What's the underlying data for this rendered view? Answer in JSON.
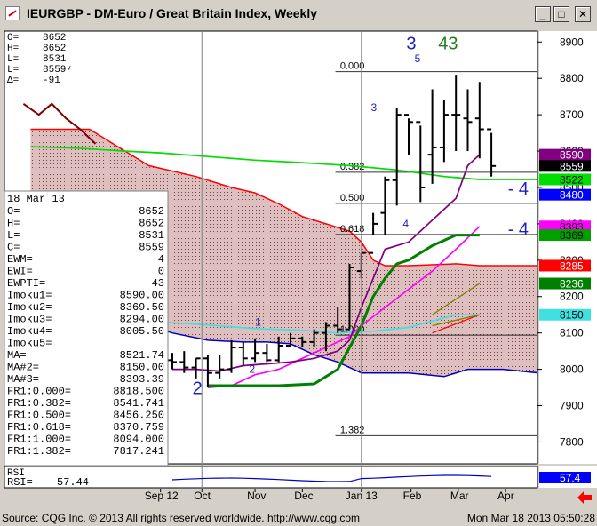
{
  "window": {
    "title": "IEURGBP - DM-Euro / Great Britain Index, Weekly",
    "buttons": [
      "_",
      "□",
      "✕"
    ]
  },
  "top_readout": [
    {
      "k": "O=",
      "v": "8652"
    },
    {
      "k": "H=",
      "v": "8652"
    },
    {
      "k": "L=",
      "v": "8531"
    },
    {
      "k": "L=",
      "v": "8559ᵛ"
    },
    {
      "k": "Δ=",
      "v": "-91"
    }
  ],
  "info_panel": {
    "date": "18 Mar 13",
    "rows": [
      {
        "k": "O=",
        "v": "8652"
      },
      {
        "k": "H=",
        "v": "8652"
      },
      {
        "k": "L=",
        "v": "8531"
      },
      {
        "k": "C=",
        "v": "8559"
      },
      {
        "k": "EWM=",
        "v": "4"
      },
      {
        "k": "EWI=",
        "v": "0"
      },
      {
        "k": "EWPTI=",
        "v": "43"
      },
      {
        "k": "Imoku1=",
        "v": "8590.00"
      },
      {
        "k": "Imoku2=",
        "v": "8369.50"
      },
      {
        "k": "Imoku3=",
        "v": "8294.00"
      },
      {
        "k": "Imoku4=",
        "v": "8005.50"
      },
      {
        "k": "Imoku5=",
        "v": ""
      },
      {
        "k": "MA=",
        "v": "8521.74"
      },
      {
        "k": "MA#2=",
        "v": "8150.00"
      },
      {
        "k": "MA#3=",
        "v": "8393.39"
      },
      {
        "k": "FR1:0.000=",
        "v": "8818.500"
      },
      {
        "k": "FR1:0.382=",
        "v": "8541.741"
      },
      {
        "k": "FR1:0.500=",
        "v": "8456.250"
      },
      {
        "k": "FR1:0.618=",
        "v": "8370.759"
      },
      {
        "k": "FR1:1.000=",
        "v": "8094.000"
      },
      {
        "k": "FR1:1.382=",
        "v": "7817.241"
      }
    ]
  },
  "rsi": {
    "label": "RSI",
    "readout_key": "RSI=",
    "readout_val": "57.44",
    "axis_value": "57.4"
  },
  "footer": {
    "left": "Source: CQG Inc. © 2013 All rights reserved worldwide. http://www.cqg.com",
    "right": "Mon Mar 18 2013 05:50:28"
  },
  "chart_data": {
    "type": "ohlc",
    "yticks": [
      7800,
      7900,
      8000,
      8100,
      8200,
      8300,
      8400,
      8500,
      8600,
      8700,
      8800,
      8900
    ],
    "ylim": [
      7740,
      8930
    ],
    "xlabels": [
      {
        "w": -1,
        "t": "Sep 12"
      },
      {
        "w": 2.5,
        "t": "Oct"
      },
      {
        "w": 7,
        "t": "Nov"
      },
      {
        "w": 11,
        "t": "Dec"
      },
      {
        "w": 16,
        "t": "Jan 13"
      },
      {
        "w": 20.2,
        "t": "Feb"
      },
      {
        "w": 24.2,
        "t": "Mar"
      },
      {
        "w": 28.2,
        "t": "Apr"
      }
    ],
    "bars": [
      {
        "o": 8025,
        "h": 8045,
        "l": 8000,
        "c": 8020
      },
      {
        "o": 8020,
        "h": 8050,
        "l": 7990,
        "c": 8005
      },
      {
        "o": 8005,
        "h": 8030,
        "l": 7975,
        "c": 8030
      },
      {
        "o": 8030,
        "h": 8040,
        "l": 7950,
        "c": 7990
      },
      {
        "o": 7990,
        "h": 8040,
        "l": 7975,
        "c": 8000
      },
      {
        "o": 8000,
        "h": 8080,
        "l": 7990,
        "c": 8060
      },
      {
        "o": 8060,
        "h": 8075,
        "l": 8010,
        "c": 8030
      },
      {
        "o": 8030,
        "h": 8085,
        "l": 8020,
        "c": 8045
      },
      {
        "o": 8045,
        "h": 8070,
        "l": 8020,
        "c": 8025
      },
      {
        "o": 8025,
        "h": 8090,
        "l": 8020,
        "c": 8065
      },
      {
        "o": 8065,
        "h": 8100,
        "l": 8060,
        "c": 8085
      },
      {
        "o": 8085,
        "h": 8090,
        "l": 8060,
        "c": 8075
      },
      {
        "o": 8075,
        "h": 8110,
        "l": 8060,
        "c": 8100
      },
      {
        "o": 8100,
        "h": 8130,
        "l": 8050,
        "c": 8120
      },
      {
        "o": 8120,
        "h": 8170,
        "l": 8100,
        "c": 8110
      },
      {
        "o": 8110,
        "h": 8290,
        "l": 8110,
        "c": 8280
      },
      {
        "o": 8270,
        "h": 8320,
        "l": 8250,
        "c": 8320
      },
      {
        "o": 8320,
        "h": 8430,
        "l": 8370,
        "c": 8400
      },
      {
        "o": 8430,
        "h": 8530,
        "l": 8370,
        "c": 8520
      },
      {
        "o": 8520,
        "h": 8720,
        "l": 8450,
        "c": 8700
      },
      {
        "o": 8700,
        "h": 8690,
        "l": 8590,
        "c": 8680
      },
      {
        "o": 8680,
        "h": 8670,
        "l": 8460,
        "c": 8500
      },
      {
        "o": 8590,
        "h": 8770,
        "l": 8510,
        "c": 8610
      },
      {
        "o": 8610,
        "h": 8740,
        "l": 8570,
        "c": 8700
      },
      {
        "o": 8700,
        "h": 8810,
        "l": 8600,
        "c": 8700
      },
      {
        "o": 8690,
        "h": 8770,
        "l": 8600,
        "c": 8680
      },
      {
        "o": 8690,
        "h": 8790,
        "l": 8580,
        "c": 8660
      },
      {
        "o": 8660,
        "h": 8650,
        "l": 8530,
        "c": 8559
      }
    ],
    "series": [
      {
        "name": "MA",
        "color": "#00dd00",
        "pts": [
          [
            -12,
            8612
          ],
          [
            -8,
            8608
          ],
          [
            -4,
            8600
          ],
          [
            -1,
            8595
          ],
          [
            3,
            8585
          ],
          [
            7,
            8575
          ],
          [
            11,
            8568
          ],
          [
            15,
            8560
          ],
          [
            19,
            8548
          ],
          [
            23,
            8530
          ],
          [
            26,
            8522
          ],
          [
            31,
            8522
          ]
        ]
      },
      {
        "name": "MA#2",
        "color": "#40e0e0",
        "pts": [
          [
            -12,
            8155
          ],
          [
            -8,
            8148
          ],
          [
            -4,
            8138
          ],
          [
            -1,
            8130
          ],
          [
            3,
            8122
          ],
          [
            7,
            8112
          ],
          [
            11,
            8107
          ],
          [
            14,
            8100
          ],
          [
            17,
            8105
          ],
          [
            20,
            8115
          ],
          [
            24,
            8150
          ],
          [
            26,
            8150
          ]
        ]
      },
      {
        "name": "MA#3",
        "color": "#ff00ff",
        "pts": [
          [
            3,
            7950
          ],
          [
            5,
            7955
          ],
          [
            7,
            7985
          ],
          [
            9,
            8000
          ],
          [
            11,
            8030
          ],
          [
            13,
            8060
          ],
          [
            15,
            8090
          ],
          [
            16,
            8120
          ],
          [
            18,
            8170
          ],
          [
            20,
            8220
          ],
          [
            22,
            8270
          ],
          [
            24,
            8330
          ],
          [
            26,
            8393
          ]
        ]
      },
      {
        "name": "Imoku1",
        "color": "#800080",
        "pts": [
          [
            0,
            8000
          ],
          [
            2,
            8000
          ],
          [
            4,
            7995
          ],
          [
            6,
            8010
          ],
          [
            8,
            8015
          ],
          [
            10,
            8020
          ],
          [
            12,
            8030
          ],
          [
            14,
            8050
          ],
          [
            15,
            8080
          ],
          [
            16,
            8170
          ],
          [
            18,
            8330
          ],
          [
            20,
            8350
          ],
          [
            22,
            8410
          ],
          [
            24,
            8470
          ],
          [
            25,
            8560
          ],
          [
            26,
            8590
          ]
        ]
      },
      {
        "name": "Imoku2",
        "color": "#008000",
        "pts": [
          [
            3,
            7955
          ],
          [
            5,
            7955
          ],
          [
            7,
            7955
          ],
          [
            9,
            7955
          ],
          [
            12,
            7960
          ],
          [
            14,
            8000
          ],
          [
            15,
            8060
          ],
          [
            16,
            8120
          ],
          [
            17,
            8200
          ],
          [
            18,
            8250
          ],
          [
            19,
            8290
          ],
          [
            20,
            8300
          ],
          [
            22,
            8340
          ],
          [
            24,
            8369
          ],
          [
            26,
            8369
          ]
        ]
      }
    ],
    "cloud_upper": [
      [
        -12,
        8660
      ],
      [
        -7,
        8660
      ],
      [
        -4,
        8600
      ],
      [
        -2,
        8560
      ],
      [
        2,
        8530
      ],
      [
        5,
        8500
      ],
      [
        7,
        8485
      ],
      [
        9,
        8455
      ],
      [
        11,
        8420
      ],
      [
        13,
        8400
      ],
      [
        15,
        8380
      ],
      [
        16,
        8350
      ],
      [
        17,
        8300
      ],
      [
        18,
        8285
      ],
      [
        20,
        8285
      ],
      [
        24,
        8290
      ],
      [
        26,
        8285
      ],
      [
        31,
        8285
      ]
    ],
    "cloud_lower": [
      [
        -12,
        8370
      ],
      [
        -10,
        8300
      ],
      [
        -8,
        8250
      ],
      [
        -6,
        8180
      ],
      [
        -3,
        8130
      ],
      [
        0,
        8100
      ],
      [
        3,
        8080
      ],
      [
        6,
        8075
      ],
      [
        8,
        8075
      ],
      [
        10,
        8070
      ],
      [
        12,
        8040
      ],
      [
        14,
        8020
      ],
      [
        16,
        7990
      ],
      [
        20,
        7990
      ],
      [
        23,
        7980
      ],
      [
        25,
        8000
      ],
      [
        28,
        8000
      ],
      [
        31,
        7990
      ]
    ],
    "prior_trend": [
      [
        -12.6,
        8730
      ],
      [
        -11.3,
        8700
      ],
      [
        -10.2,
        8730
      ],
      [
        -9.0,
        8690
      ],
      [
        -7.8,
        8660
      ],
      [
        -6.5,
        8620
      ]
    ],
    "fib": [
      {
        "lvl": "0.000",
        "y": 8818.5
      },
      {
        "lvl": "0.382",
        "y": 8541.741
      },
      {
        "lvl": "0.500",
        "y": 8456.25
      },
      {
        "lvl": "0.618",
        "y": 8370.759
      },
      {
        "lvl": "1.000",
        "y": 8094
      },
      {
        "lvl": "1.382",
        "y": 7817.241
      }
    ],
    "wave_labels": [
      {
        "t": "2",
        "w": 1.7,
        "y": 7932,
        "color": "#2020c0",
        "size": 20
      },
      {
        "t": "2",
        "w": 6.5,
        "y": 7990,
        "color": "#2020c0",
        "size": 12
      },
      {
        "t": "1",
        "w": 7.0,
        "y": 8120,
        "color": "#2020c0",
        "size": 12
      },
      {
        "t": "3",
        "w": 16.8,
        "y": 8710,
        "color": "#2020c0",
        "size": 12
      },
      {
        "t": "5",
        "w": 20.5,
        "y": 8845,
        "color": "#2020c0",
        "size": 12
      },
      {
        "t": "4",
        "w": 19.5,
        "y": 8390,
        "color": "#2020c0",
        "size": 12
      },
      {
        "t": "3",
        "w": 19.8,
        "y": 8880,
        "color": "#2020c0",
        "size": 20
      },
      {
        "t": "43",
        "w": 22.5,
        "y": 8880,
        "color": "#208020",
        "size": 20
      },
      {
        "t": "- 4",
        "w": 28.4,
        "y": 8480,
        "color": "#2020c0",
        "size": 20
      },
      {
        "t": "- 4",
        "w": 28.4,
        "y": 8369,
        "color": "#2020c0",
        "size": 20
      }
    ],
    "price_tags": [
      {
        "v": "8590",
        "y": 8590,
        "bg": "#800080",
        "fg": "#ffffff"
      },
      {
        "v": "8559",
        "y": 8559,
        "bg": "#000000",
        "fg": "#ffffff"
      },
      {
        "v": "8522",
        "y": 8522,
        "bg": "#00dd00",
        "fg": "#000000"
      },
      {
        "v": "8480",
        "y": 8480,
        "bg": "#0000ff",
        "fg": "#ffffff"
      },
      {
        "v": "8393",
        "y": 8393,
        "bg": "#ff00ff",
        "fg": "#000000"
      },
      {
        "v": "8369",
        "y": 8369,
        "bg": "#00a000",
        "fg": "#000000"
      },
      {
        "v": "8285",
        "y": 8285,
        "bg": "#ff0000",
        "fg": "#ffffff"
      },
      {
        "v": "8236",
        "y": 8236,
        "bg": "#008000",
        "fg": "#ffffff"
      },
      {
        "v": "8150",
        "y": 8150,
        "bg": "#40e0e0",
        "fg": "#000000"
      }
    ],
    "colors": {
      "cloud_fill": "#d8b4b4",
      "cloud_line_upper": "#ff0000",
      "cloud_line_lower": "#0000c0",
      "bars": "#000000",
      "fib": "#000000",
      "trend": "#800000"
    }
  }
}
